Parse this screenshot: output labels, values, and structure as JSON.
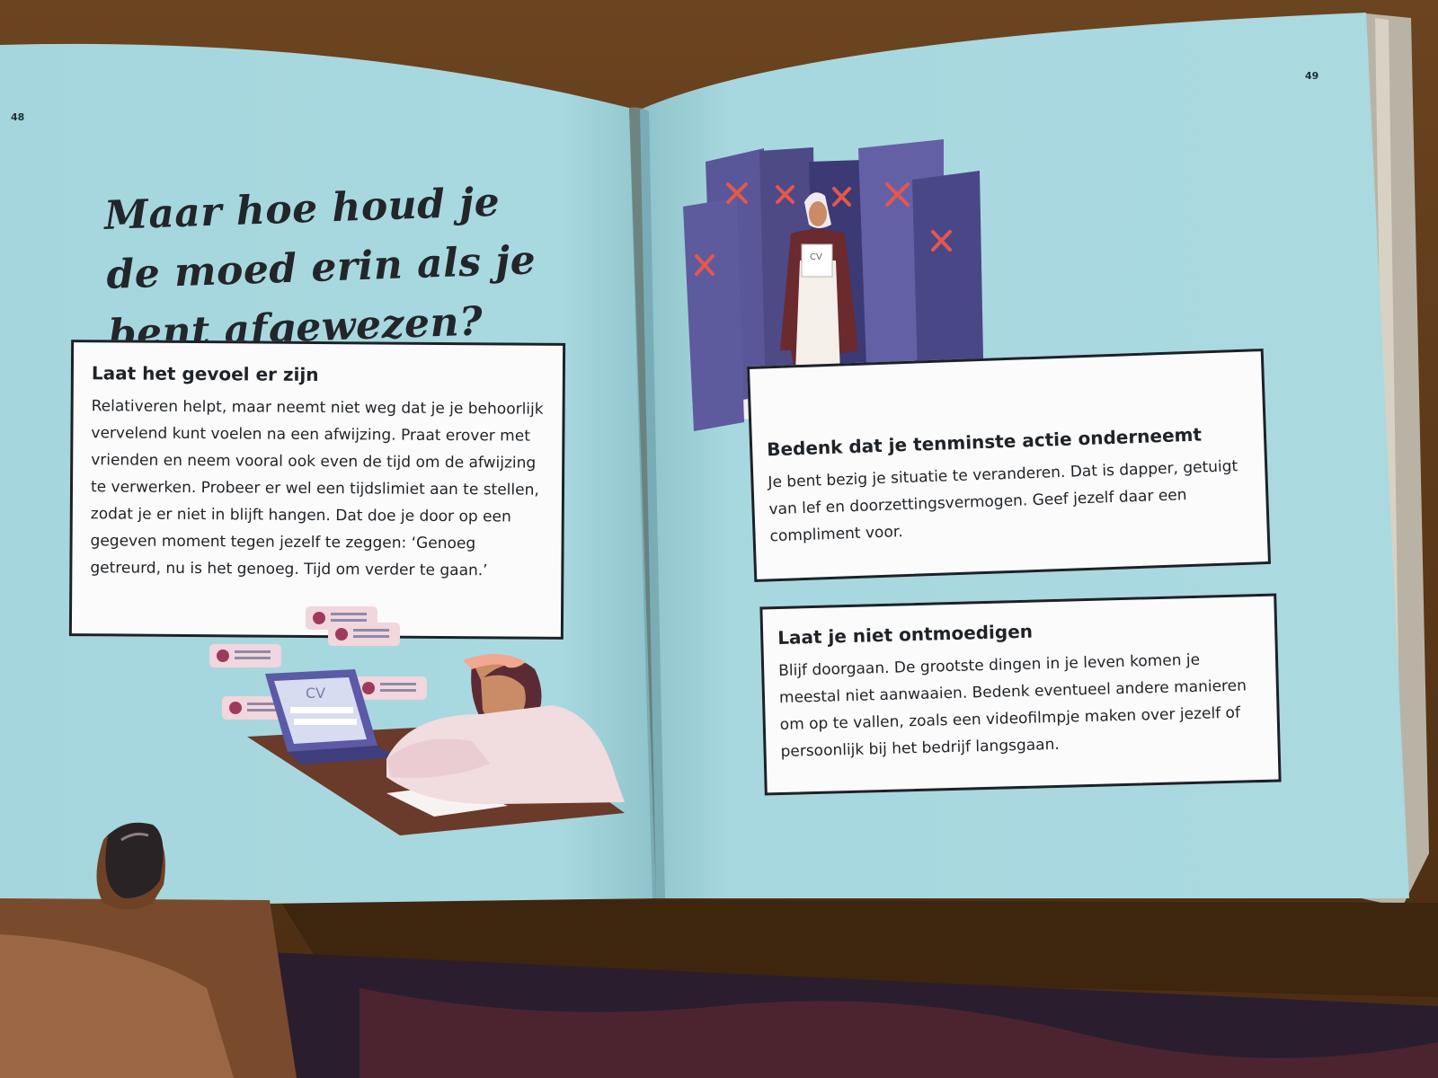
{
  "page_numbers": {
    "left": "48",
    "right": "49"
  },
  "headline": "Maar hoe houd je de moed erin als je bent afgewezen?",
  "cards": [
    {
      "title": "Laat het gevoel er zijn",
      "body": "Relativeren helpt, maar neemt niet weg dat je je behoorlijk vervelend kunt voelen na een afwijzing. Praat erover met vrienden en neem vooral ook even de tijd om de afwijzing te verwerken. Probeer er wel een tijdslimiet aan te stellen, zodat je er niet in blijft hangen. Dat doe je door op een gegeven moment tegen jezelf te zeggen: ‘Genoeg getreurd, nu is het genoeg. Tijd om verder te gaan.’"
    },
    {
      "title": "Bedenk dat je tenminste actie onderneemt",
      "body": "Je bent bezig je situatie te veranderen. Dat is dapper, getuigt van lef en doorzettingsvermogen. Geef jezelf daar een compliment voor."
    },
    {
      "title": "Laat je niet ontmoedigen",
      "body": "Blijf doorgaan. De grootste dingen in je leven komen je meestal niet aanwaaien. Bedenk eventueel andere manieren om op te vallen, zoals een videofilmpje maken over jezelf of persoonlijk bij het bedrijf langsgaan."
    }
  ],
  "illustrations": {
    "laptop_label": "CV",
    "paper_label": "CV"
  },
  "colors": {
    "page": "#a9d8de",
    "door": "#4d4a86",
    "x_mark": "#e4574d",
    "card": "#fbfbfb"
  }
}
